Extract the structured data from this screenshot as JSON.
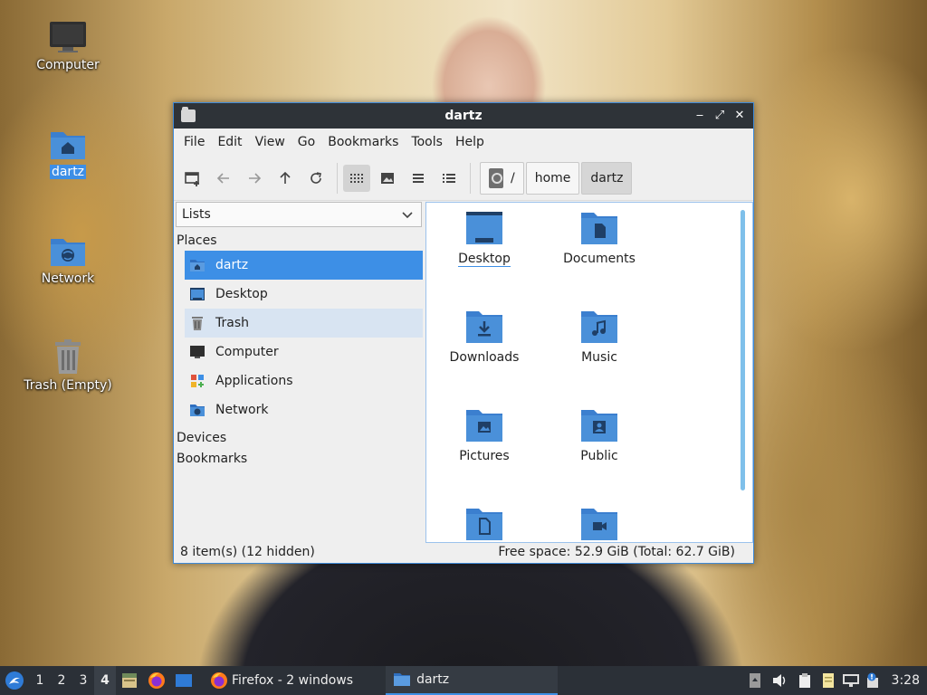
{
  "desktop": {
    "icons": [
      {
        "label": "Computer",
        "icon": "computer-icon"
      },
      {
        "label": "dartz",
        "icon": "home-folder-icon"
      },
      {
        "label": "Network",
        "icon": "network-folder-icon"
      },
      {
        "label": "Trash (Empty)",
        "icon": "trash-icon"
      }
    ]
  },
  "window": {
    "title": "dartz",
    "controls": {
      "minimize": "‒",
      "maximize": "⤢",
      "close": "✕"
    },
    "menu": [
      "File",
      "Edit",
      "View",
      "Go",
      "Bookmarks",
      "Tools",
      "Help"
    ],
    "toolbar": {
      "buttons": [
        "new-tab",
        "back",
        "forward",
        "up",
        "reload",
        "icon-view",
        "thumbnail-view",
        "compact-view",
        "detailed-list-view"
      ],
      "path": [
        "/",
        "home",
        "dartz"
      ]
    },
    "sidebar": {
      "view_mode": "Lists",
      "places_header": "Places",
      "places": [
        {
          "label": "dartz",
          "icon": "home-folder-icon"
        },
        {
          "label": "Desktop",
          "icon": "desktop-icon"
        },
        {
          "label": "Trash",
          "icon": "trash-icon"
        },
        {
          "label": "Computer",
          "icon": "computer-icon"
        },
        {
          "label": "Applications",
          "icon": "applications-icon"
        },
        {
          "label": "Network",
          "icon": "network-folder-icon"
        }
      ],
      "devices_header": "Devices",
      "bookmarks_header": "Bookmarks"
    },
    "files": [
      {
        "name": "Desktop",
        "icon": "desktop-folder-icon"
      },
      {
        "name": "Documents",
        "icon": "documents-folder-icon"
      },
      {
        "name": "Downloads",
        "icon": "downloads-folder-icon"
      },
      {
        "name": "Music",
        "icon": "music-folder-icon"
      },
      {
        "name": "Pictures",
        "icon": "pictures-folder-icon"
      },
      {
        "name": "Public",
        "icon": "public-folder-icon"
      },
      {
        "name": "",
        "icon": "templates-folder-icon"
      },
      {
        "name": "",
        "icon": "videos-folder-icon"
      }
    ],
    "status": {
      "items": "8 item(s) (12 hidden)",
      "free_space": "Free space: 52.9 GiB (Total: 62.7 GiB)"
    }
  },
  "taskbar": {
    "workspaces": [
      "1",
      "2",
      "3",
      "4"
    ],
    "active_workspace": "4",
    "tasks": [
      {
        "label": "Firefox - 2 windows",
        "icon": "firefox-icon"
      },
      {
        "label": "dartz",
        "icon": "folder-icon"
      }
    ],
    "clock": "3:28"
  },
  "colors": {
    "accent": "#3d8fe6",
    "folder": "#4a90d9",
    "titlebar": "#2e3338",
    "taskbar": "#2b3037"
  }
}
